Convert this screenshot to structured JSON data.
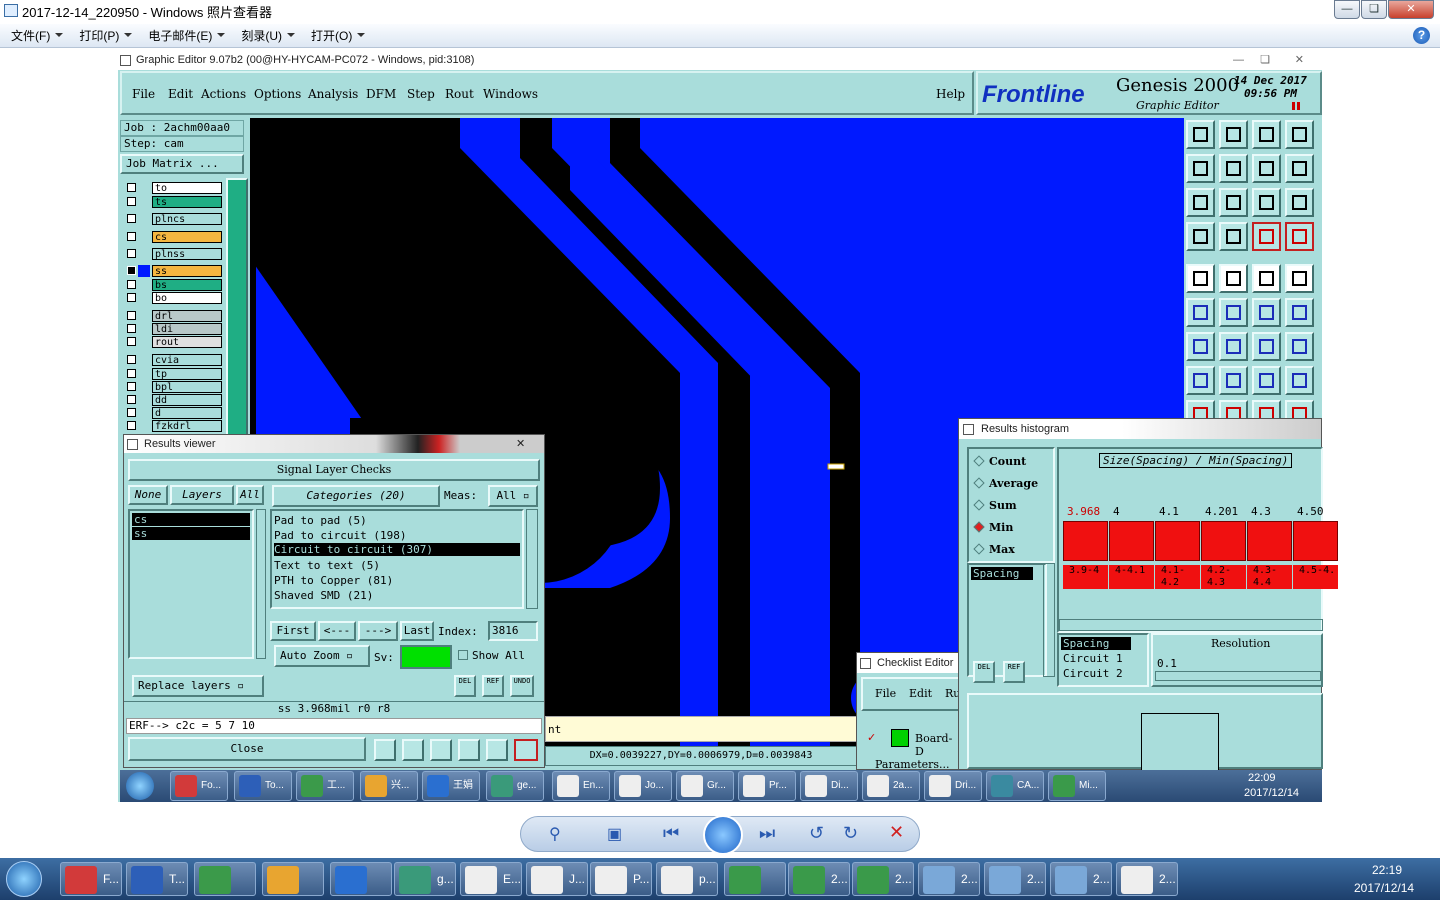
{
  "viewer": {
    "title": "2017-12-14_220950 - Windows 照片查看器",
    "menu": [
      "文件(F)",
      "打印(P)",
      "电子邮件(E)",
      "刻录(U)",
      "打开(O)"
    ]
  },
  "genesis": {
    "window_title": "Graphic Editor 9.07b2 (00@HY-HYCAM-PC072 - Windows, pid:3108)",
    "menu": [
      "File",
      "Edit",
      "Actions",
      "Options",
      "Analysis",
      "DFM",
      "Step",
      "Rout",
      "Windows"
    ],
    "help": "Help",
    "logo": "Frontline",
    "product": "Genesis 2000",
    "product_sub": "Graphic Editor",
    "date": "14 Dec 2017",
    "time": "09:56 PM",
    "job": "Job : 2achm00aa0",
    "step": "Step: cam",
    "job_matrix": "Job Matrix ...",
    "layers": [
      {
        "name": "to",
        "color": "#ffffff"
      },
      {
        "name": "ts",
        "color": "#1fae84"
      },
      {
        "name": "plncs",
        "color": "#a9dddb"
      },
      {
        "name": "cs",
        "color": "#f5b640"
      },
      {
        "name": "plnss",
        "color": "#a9dddb"
      },
      {
        "name": "ss",
        "color": "#f5b640"
      },
      {
        "name": "bs",
        "color": "#1fae84"
      },
      {
        "name": "bo",
        "color": "#ffffff"
      },
      {
        "name": "drl",
        "color": "#b8c8c8"
      },
      {
        "name": "ldi",
        "color": "#b8c8c8"
      },
      {
        "name": "rout",
        "color": "#e0e0e0"
      },
      {
        "name": "cvia",
        "color": "#a9dddb"
      },
      {
        "name": "tp",
        "color": "#a9dddb"
      },
      {
        "name": "bpl",
        "color": "#a9dddb"
      },
      {
        "name": "dd",
        "color": "#a9dddb"
      },
      {
        "name": "d",
        "color": "#a9dddb"
      },
      {
        "name": "fzkdrl",
        "color": "#a9dddb"
      }
    ],
    "coords": "DX=0.0039227,DY=0.0006979,D=0.0039843",
    "status_fragment": "nt"
  },
  "results_viewer": {
    "title": "Results viewer",
    "header": "Signal Layer Checks",
    "none": "None",
    "layers": "Layers",
    "all": "All",
    "categories": "Categories (20)",
    "meas_label": "Meas:",
    "meas_value": "All",
    "layer_items": [
      "cs",
      "ss"
    ],
    "category_items": [
      "Pad to pad (5)",
      "Pad to circuit (198)",
      "Circuit to circuit (307)",
      "Text to text (5)",
      "PTH to Copper (81)",
      "Shaved SMD (21)"
    ],
    "first": "First",
    "prev": "<---",
    "next": "--->",
    "last": "Last",
    "index_label": "Index:",
    "index_value": "3816",
    "auto_zoom": "Auto Zoom",
    "sv": "Sv:",
    "show_all": "Show All",
    "replace_layers": "Replace layers",
    "del": "DEL",
    "ref": "REF",
    "undo": "UNDO",
    "measure": "ss 3.968mil  r0  r8",
    "erf": "ERF--> c2c = 5 7 10",
    "close": "Close"
  },
  "histogram": {
    "title": "Results histogram",
    "options": [
      "Count",
      "Average",
      "Sum",
      "Min",
      "Max"
    ],
    "selected_option": "Min",
    "list_item": "Spacing",
    "chart_title": "Size(Spacing) / Min(Spacing)",
    "values": [
      "3.968",
      "4",
      "4.1",
      "4.201",
      "4.3",
      "4.50"
    ],
    "ranges": [
      "3.9-4",
      "4-4.1",
      "4.1-4.2",
      "4.2-4.3",
      "4.3-4.4",
      "4.5-4."
    ],
    "legend": [
      "Spacing",
      "Circuit 1",
      "Circuit 2"
    ],
    "resolution_label": "Resolution",
    "resolution_value": "0.1",
    "del": "DEL",
    "ref": "REF"
  },
  "checklist": {
    "title": "Checklist Editor",
    "menu": [
      "File",
      "Edit",
      "Ru"
    ],
    "item": "Board-D",
    "params": "Parameters..."
  },
  "taskbar_inner": {
    "items": [
      "Fo...",
      "To...",
      "工...",
      "兴...",
      "王娟",
      "ge...",
      "En...",
      "Jo...",
      "Gr...",
      "Pr...",
      "Di...",
      "2a...",
      "Dri...",
      "CA...",
      "Mi..."
    ],
    "time": "22:09",
    "date": "2017/12/14"
  },
  "taskbar_outer": {
    "items": [
      "F...",
      "T...",
      "",
      "",
      "",
      "g...",
      "E...",
      "J...",
      "P...",
      "p...",
      "",
      "2...",
      "2...",
      "2...",
      "2...",
      "2...",
      "2..."
    ],
    "time": "22:19",
    "date": "2017/12/14"
  }
}
